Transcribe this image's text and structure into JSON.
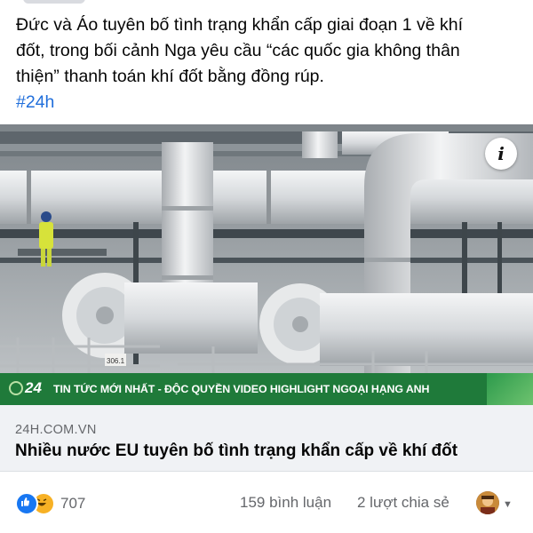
{
  "post": {
    "text_lines": [
      "Đức và Áo tuyên bố tình trạng khẩn cấp giai đoạn 1 về khí",
      "đốt, trong bối cảnh Nga yêu cầu “các quốc gia không thân",
      "thiện” thanh toán khí đốt bằng đồng rúp."
    ],
    "hashtag": "#24h"
  },
  "photo": {
    "info_glyph": "i",
    "ticker_logo": "24",
    "ticker_text": "TIN TỨC MỚI NHẤT - ĐỘC QUYỀN VIDEO HIGHLIGHT NGOẠI HẠNG ANH",
    "pipe_label": "306.1"
  },
  "link": {
    "domain": "24H.COM.VN",
    "title": "Nhiều nước EU tuyên bố tình trạng khẩn cấp về khí đốt"
  },
  "engagement": {
    "reaction_count": "707",
    "comments": "159 bình luận",
    "shares": "2 lượt chia sẻ"
  },
  "icons": {
    "like": "like-icon",
    "haha": "haha-icon",
    "info": "info-icon",
    "caret": "caret-down-icon"
  },
  "colors": {
    "hashtag": "#216fdb",
    "banner": "#1f7a3a",
    "like": "#1877f2",
    "haha": "#f7b125"
  }
}
